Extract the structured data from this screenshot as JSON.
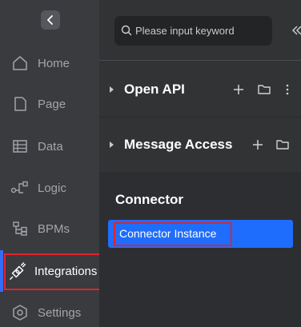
{
  "nav": {
    "items": [
      {
        "label": "Home",
        "icon": "home-icon"
      },
      {
        "label": "Page",
        "icon": "page-icon"
      },
      {
        "label": "Data",
        "icon": "table-icon"
      },
      {
        "label": "Logic",
        "icon": "logic-flow-icon"
      },
      {
        "label": "BPMs",
        "icon": "bpm-tree-icon"
      },
      {
        "label": "Integrations",
        "icon": "plug-icon",
        "active": true
      },
      {
        "label": "Settings",
        "icon": "settings-hexagon-icon"
      }
    ]
  },
  "search": {
    "placeholder": "Please input keyword",
    "value": ""
  },
  "groups": [
    {
      "title": "Open API",
      "actions": [
        "add",
        "folder",
        "more"
      ]
    },
    {
      "title": "Message Access",
      "actions": [
        "add",
        "folder"
      ]
    }
  ],
  "section": {
    "title": "Connector",
    "items": [
      {
        "label": "Connector Instance",
        "selected": true
      }
    ]
  },
  "colors": {
    "accent": "#1f6dfc",
    "highlight_border": "#e0242b",
    "rail_bg": "#3a3b3e",
    "panel_bg": "#323335"
  }
}
